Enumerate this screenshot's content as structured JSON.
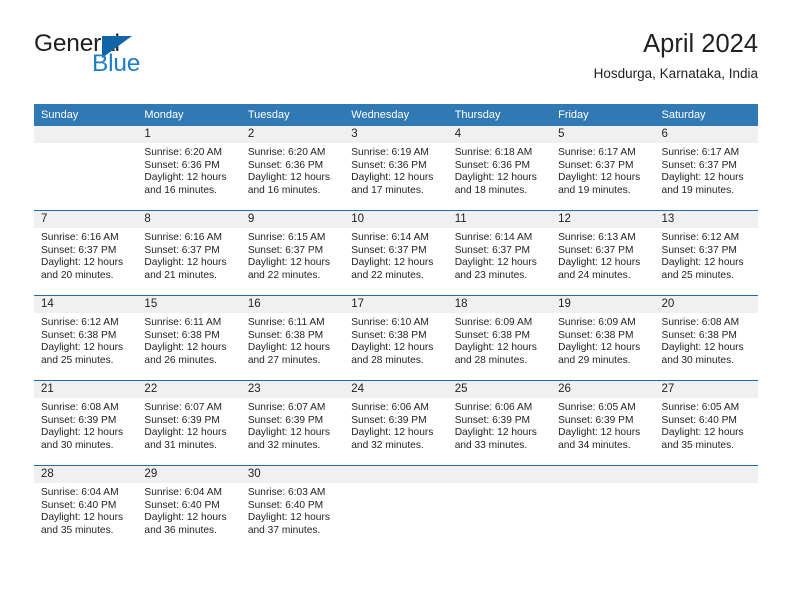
{
  "brand": {
    "name_part1": "General",
    "name_part2": "Blue",
    "triangle_icon": "triangle-icon",
    "accent_color": "#1f7fc4",
    "triangle_color": "#1064a8"
  },
  "header": {
    "title": "April 2024",
    "subtitle": "Hosdurga, Karnataka, India"
  },
  "theme": {
    "header_bg": "#3179b5",
    "row_divider": "#1f6cb0",
    "daynum_band_bg": "#f0f0f0",
    "text": "#231f20"
  },
  "weekdays": [
    "Sunday",
    "Monday",
    "Tuesday",
    "Wednesday",
    "Thursday",
    "Friday",
    "Saturday"
  ],
  "weeks": [
    [
      {
        "day": "",
        "empty": true,
        "sunrise": "",
        "sunset": "",
        "daylight1": "",
        "daylight2": ""
      },
      {
        "day": "1",
        "sunrise": "Sunrise: 6:20 AM",
        "sunset": "Sunset: 6:36 PM",
        "daylight1": "Daylight: 12 hours",
        "daylight2": "and 16 minutes."
      },
      {
        "day": "2",
        "sunrise": "Sunrise: 6:20 AM",
        "sunset": "Sunset: 6:36 PM",
        "daylight1": "Daylight: 12 hours",
        "daylight2": "and 16 minutes."
      },
      {
        "day": "3",
        "sunrise": "Sunrise: 6:19 AM",
        "sunset": "Sunset: 6:36 PM",
        "daylight1": "Daylight: 12 hours",
        "daylight2": "and 17 minutes."
      },
      {
        "day": "4",
        "sunrise": "Sunrise: 6:18 AM",
        "sunset": "Sunset: 6:36 PM",
        "daylight1": "Daylight: 12 hours",
        "daylight2": "and 18 minutes."
      },
      {
        "day": "5",
        "sunrise": "Sunrise: 6:17 AM",
        "sunset": "Sunset: 6:37 PM",
        "daylight1": "Daylight: 12 hours",
        "daylight2": "and 19 minutes."
      },
      {
        "day": "6",
        "sunrise": "Sunrise: 6:17 AM",
        "sunset": "Sunset: 6:37 PM",
        "daylight1": "Daylight: 12 hours",
        "daylight2": "and 19 minutes."
      }
    ],
    [
      {
        "day": "7",
        "sunrise": "Sunrise: 6:16 AM",
        "sunset": "Sunset: 6:37 PM",
        "daylight1": "Daylight: 12 hours",
        "daylight2": "and 20 minutes."
      },
      {
        "day": "8",
        "sunrise": "Sunrise: 6:16 AM",
        "sunset": "Sunset: 6:37 PM",
        "daylight1": "Daylight: 12 hours",
        "daylight2": "and 21 minutes."
      },
      {
        "day": "9",
        "sunrise": "Sunrise: 6:15 AM",
        "sunset": "Sunset: 6:37 PM",
        "daylight1": "Daylight: 12 hours",
        "daylight2": "and 22 minutes."
      },
      {
        "day": "10",
        "sunrise": "Sunrise: 6:14 AM",
        "sunset": "Sunset: 6:37 PM",
        "daylight1": "Daylight: 12 hours",
        "daylight2": "and 22 minutes."
      },
      {
        "day": "11",
        "sunrise": "Sunrise: 6:14 AM",
        "sunset": "Sunset: 6:37 PM",
        "daylight1": "Daylight: 12 hours",
        "daylight2": "and 23 minutes."
      },
      {
        "day": "12",
        "sunrise": "Sunrise: 6:13 AM",
        "sunset": "Sunset: 6:37 PM",
        "daylight1": "Daylight: 12 hours",
        "daylight2": "and 24 minutes."
      },
      {
        "day": "13",
        "sunrise": "Sunrise: 6:12 AM",
        "sunset": "Sunset: 6:37 PM",
        "daylight1": "Daylight: 12 hours",
        "daylight2": "and 25 minutes."
      }
    ],
    [
      {
        "day": "14",
        "sunrise": "Sunrise: 6:12 AM",
        "sunset": "Sunset: 6:38 PM",
        "daylight1": "Daylight: 12 hours",
        "daylight2": "and 25 minutes."
      },
      {
        "day": "15",
        "sunrise": "Sunrise: 6:11 AM",
        "sunset": "Sunset: 6:38 PM",
        "daylight1": "Daylight: 12 hours",
        "daylight2": "and 26 minutes."
      },
      {
        "day": "16",
        "sunrise": "Sunrise: 6:11 AM",
        "sunset": "Sunset: 6:38 PM",
        "daylight1": "Daylight: 12 hours",
        "daylight2": "and 27 minutes."
      },
      {
        "day": "17",
        "sunrise": "Sunrise: 6:10 AM",
        "sunset": "Sunset: 6:38 PM",
        "daylight1": "Daylight: 12 hours",
        "daylight2": "and 28 minutes."
      },
      {
        "day": "18",
        "sunrise": "Sunrise: 6:09 AM",
        "sunset": "Sunset: 6:38 PM",
        "daylight1": "Daylight: 12 hours",
        "daylight2": "and 28 minutes."
      },
      {
        "day": "19",
        "sunrise": "Sunrise: 6:09 AM",
        "sunset": "Sunset: 6:38 PM",
        "daylight1": "Daylight: 12 hours",
        "daylight2": "and 29 minutes."
      },
      {
        "day": "20",
        "sunrise": "Sunrise: 6:08 AM",
        "sunset": "Sunset: 6:38 PM",
        "daylight1": "Daylight: 12 hours",
        "daylight2": "and 30 minutes."
      }
    ],
    [
      {
        "day": "21",
        "sunrise": "Sunrise: 6:08 AM",
        "sunset": "Sunset: 6:39 PM",
        "daylight1": "Daylight: 12 hours",
        "daylight2": "and 30 minutes."
      },
      {
        "day": "22",
        "sunrise": "Sunrise: 6:07 AM",
        "sunset": "Sunset: 6:39 PM",
        "daylight1": "Daylight: 12 hours",
        "daylight2": "and 31 minutes."
      },
      {
        "day": "23",
        "sunrise": "Sunrise: 6:07 AM",
        "sunset": "Sunset: 6:39 PM",
        "daylight1": "Daylight: 12 hours",
        "daylight2": "and 32 minutes."
      },
      {
        "day": "24",
        "sunrise": "Sunrise: 6:06 AM",
        "sunset": "Sunset: 6:39 PM",
        "daylight1": "Daylight: 12 hours",
        "daylight2": "and 32 minutes."
      },
      {
        "day": "25",
        "sunrise": "Sunrise: 6:06 AM",
        "sunset": "Sunset: 6:39 PM",
        "daylight1": "Daylight: 12 hours",
        "daylight2": "and 33 minutes."
      },
      {
        "day": "26",
        "sunrise": "Sunrise: 6:05 AM",
        "sunset": "Sunset: 6:39 PM",
        "daylight1": "Daylight: 12 hours",
        "daylight2": "and 34 minutes."
      },
      {
        "day": "27",
        "sunrise": "Sunrise: 6:05 AM",
        "sunset": "Sunset: 6:40 PM",
        "daylight1": "Daylight: 12 hours",
        "daylight2": "and 35 minutes."
      }
    ],
    [
      {
        "day": "28",
        "sunrise": "Sunrise: 6:04 AM",
        "sunset": "Sunset: 6:40 PM",
        "daylight1": "Daylight: 12 hours",
        "daylight2": "and 35 minutes."
      },
      {
        "day": "29",
        "sunrise": "Sunrise: 6:04 AM",
        "sunset": "Sunset: 6:40 PM",
        "daylight1": "Daylight: 12 hours",
        "daylight2": "and 36 minutes."
      },
      {
        "day": "30",
        "sunrise": "Sunrise: 6:03 AM",
        "sunset": "Sunset: 6:40 PM",
        "daylight1": "Daylight: 12 hours",
        "daylight2": "and 37 minutes."
      },
      {
        "day": "",
        "empty": true,
        "sunrise": "",
        "sunset": "",
        "daylight1": "",
        "daylight2": ""
      },
      {
        "day": "",
        "empty": true,
        "sunrise": "",
        "sunset": "",
        "daylight1": "",
        "daylight2": ""
      },
      {
        "day": "",
        "empty": true,
        "sunrise": "",
        "sunset": "",
        "daylight1": "",
        "daylight2": ""
      },
      {
        "day": "",
        "empty": true,
        "sunrise": "",
        "sunset": "",
        "daylight1": "",
        "daylight2": ""
      }
    ]
  ]
}
